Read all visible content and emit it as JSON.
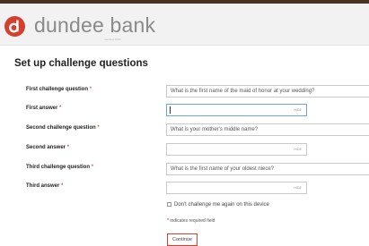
{
  "colors": {
    "brand_red": "#d43f2e",
    "top_bar": "#4a3324"
  },
  "icons": {
    "logo": "dundee-d-logo-icon"
  },
  "header": {
    "brand_name": "dundee bank",
    "tagline": "member FDIC"
  },
  "page": {
    "title": "Set up challenge questions"
  },
  "form": {
    "required_marker": "*",
    "hide_label": "HIDE",
    "q1": {
      "label": "First challenge question",
      "value": "What is the first name of the maid of honor at your wedding?"
    },
    "a1": {
      "label": "First answer",
      "value": ""
    },
    "q2": {
      "label": "Second challenge question",
      "value": "What is your mother's middle name?"
    },
    "a2": {
      "label": "Second answer",
      "value": ""
    },
    "q3": {
      "label": "Third challenge question",
      "value": "What is the first name of your oldest niece?"
    },
    "a3": {
      "label": "Third answer",
      "value": ""
    },
    "dont_challenge_label": "Don't challenge me again on this device",
    "required_note": "indicates required field",
    "continue_label": "Continue"
  }
}
